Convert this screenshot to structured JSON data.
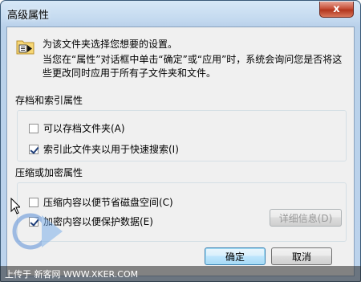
{
  "window": {
    "title": "高级属性",
    "close_glyph": "x"
  },
  "header": {
    "line1": "为该文件夹选择您想要的设置。",
    "line2": "当您在“属性”对话框中单击“确定”或“应用”时，系统会询问您是否将这些更改同时应用于所有子文件夹和文件。"
  },
  "archive_group": {
    "title": "存档和索引属性",
    "options": [
      {
        "label": "可以存档文件夹(A)",
        "checked": false
      },
      {
        "label": "索引此文件夹以用于快速搜索(I)",
        "checked": true
      }
    ]
  },
  "compress_group": {
    "title": "压缩或加密属性",
    "options": [
      {
        "label": "压缩内容以便节省磁盘空间(C)",
        "checked": false
      },
      {
        "label": "加密内容以便保护数据(E)",
        "checked": true
      }
    ],
    "details_button": "详细信息(D)"
  },
  "buttons": {
    "ok": "确定",
    "cancel": "取消"
  },
  "watermark": {
    "text": "上传于 新客网 WWW.XKER.COM"
  }
}
